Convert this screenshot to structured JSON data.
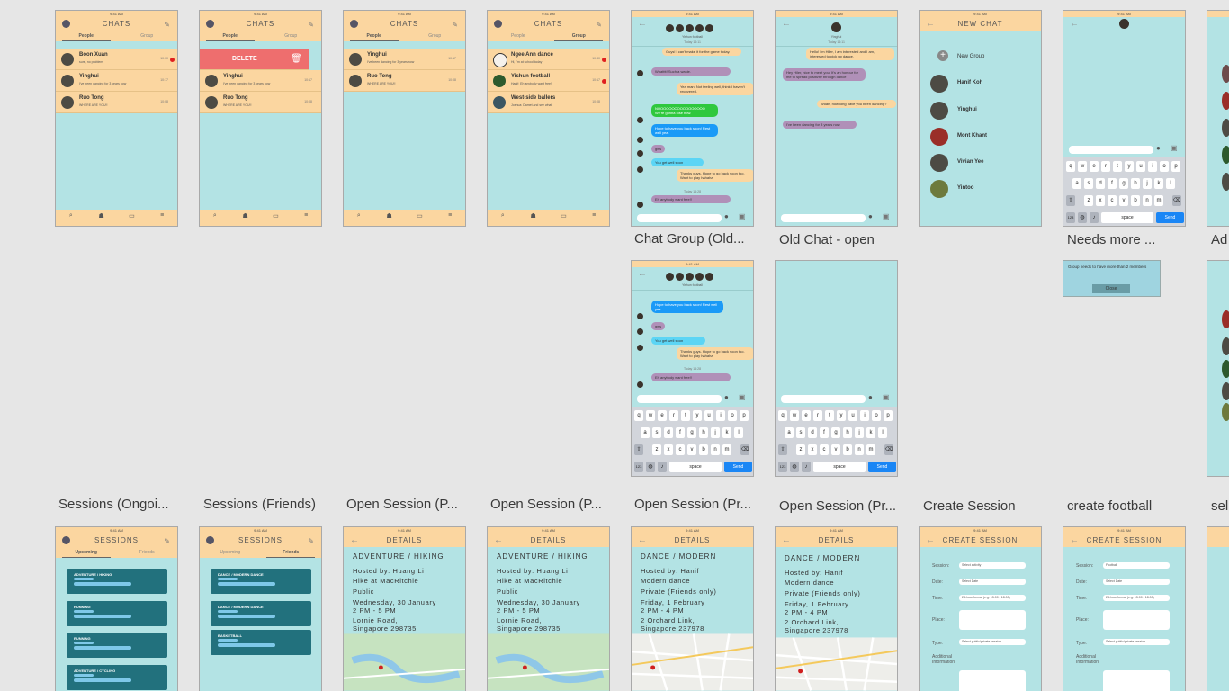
{
  "status_time": "9:41 AM",
  "colors": {
    "canvas": "#e6e6e6",
    "phone_bg": "#b3e3e4",
    "header": "#fbd6a0",
    "badge": "#e01f1f",
    "card": "#22717d",
    "send": "#1a86f5"
  },
  "chats": {
    "title": "CHATS",
    "tab_people": "People",
    "tab_group": "Group",
    "rows": [
      {
        "name": "Boon Xuan",
        "msg": "sure, no problem!",
        "time": "10:00"
      },
      {
        "name": "Yinghui",
        "msg": "I've been dancing for 3 years now",
        "time": "10:17"
      },
      {
        "name": "Ruo Tong",
        "msg": "WHERE ARE YOU!!",
        "time": "10:08"
      }
    ],
    "delete_label": "DELETE",
    "group_rows": [
      {
        "name": "Ngee Ann dance",
        "msg": "Hi, I'm at school today",
        "time": "10:30"
      },
      {
        "name": "Yishun football",
        "msg": "Hanif: Eh anybody want free!",
        "time": "10:17"
      },
      {
        "name": "West-side ballers",
        "msg": "Joshua: Damet and see what",
        "time": "10:08"
      }
    ]
  },
  "group_chat": {
    "group_name": "Yishun football",
    "date1": "Today 16:11",
    "date2": "Today 16:28",
    "msgs": [
      "Guys! I can't make it for the game today.",
      "Whatttt! Such a waste.",
      "Yea man. Not feeling well, think I haven't recovered.",
      "NOOOOOOOOOOOOOOOOO We're gonna lose now.",
      "Hope to have you back soon! Rest well yea.",
      "gws",
      "You get well soon",
      "Thanks guys. Hope to go back soon too. Want to play hahaha",
      "Eh anybody want free!!"
    ]
  },
  "old_chat": {
    "contact": "Yinghui",
    "date": "Today 16:11",
    "msgs": [
      "Hello! I'm Hiler, I am interested and I am, interested to pick up dance.",
      "Hey Hiler, nice to meet you! It's an honour for me to spread positivity through dance",
      "Woah, how long have you been dancing?",
      "I've been dancing for 3 years now"
    ]
  },
  "new_chat": {
    "title": "NEW CHAT",
    "new_group": "New Group",
    "contacts": [
      "Hanif Koh",
      "Yinghui",
      "Mont Khant",
      "Vivian Yee",
      "Yintoo"
    ]
  },
  "keyboard": {
    "row1": [
      "q",
      "w",
      "e",
      "r",
      "t",
      "y",
      "u",
      "i",
      "o",
      "p"
    ],
    "row2": [
      "a",
      "s",
      "d",
      "f",
      "g",
      "h",
      "j",
      "k",
      "l"
    ],
    "row3": [
      "z",
      "x",
      "c",
      "v",
      "b",
      "n",
      "m"
    ],
    "num_key": "123",
    "space_key": "space",
    "send_key": "Send"
  },
  "error_popup": {
    "msg": "Group needs to have more than 2 members",
    "btn": "Close"
  },
  "captions": {
    "chat_group": "Chat Group (Old...",
    "old_chat": "Old Chat - open",
    "needs_more": "Needs more ...",
    "ad": "Ad",
    "sessions_ongoing": "Sessions (Ongoi...",
    "sessions_friends": "Sessions (Friends)",
    "open_session_p1": "Open Session (P...",
    "open_session_p2": "Open Session (P...",
    "open_session_pr1": "Open Session (Pr...",
    "open_session_pr2": "Open Session (Pr...",
    "create_session": "Create Session",
    "create_football": "create football",
    "sel": "sel"
  },
  "sessions": {
    "title": "SESSIONS",
    "tab_upcoming": "Upcoming",
    "tab_friends": "Friends",
    "cards_ongoing": [
      "ADVENTURE / HIKING",
      "RUNNING",
      "RUNNING",
      "ADVENTURE / CYCLING"
    ],
    "cards_friends": [
      "DANCE / MODERN DANCE",
      "DANCE / MODERN DANCE",
      "BASKETBALL"
    ]
  },
  "details": {
    "title": "DETAILS",
    "hiking": {
      "category": "ADVENTURE / HIKING",
      "host": "Hosted by: Huang Li",
      "name": "Hike at MacRitchie",
      "privacy": "Public",
      "date": "Wednesday, 30 January",
      "time": "2 PM - 5 PM",
      "loc1": "Lornie Road,",
      "loc2": "Singapore 298735"
    },
    "dance": {
      "category": "DANCE / MODERN",
      "host": "Hosted by: Hanif",
      "name": "Modern dance",
      "privacy": "Private (Friends only)",
      "date": "Friday, 1 February",
      "time": "2 PM - 4 PM",
      "loc1": "2 Orchard Link,",
      "loc2": "Singapore 237978"
    }
  },
  "create": {
    "title": "CREATE SESSION",
    "labels": {
      "session": "Session:",
      "date": "Date:",
      "time": "Time:",
      "place": "Place:",
      "type": "Type:",
      "info1": "Additional",
      "info2": "Information:"
    },
    "session_default": "Select activity",
    "session_football": "Football",
    "date_ph": "Select Date",
    "time_ph": "24-hour format (e.g. 15:00 - 18:00)",
    "type_ph": "Select public/private session"
  }
}
